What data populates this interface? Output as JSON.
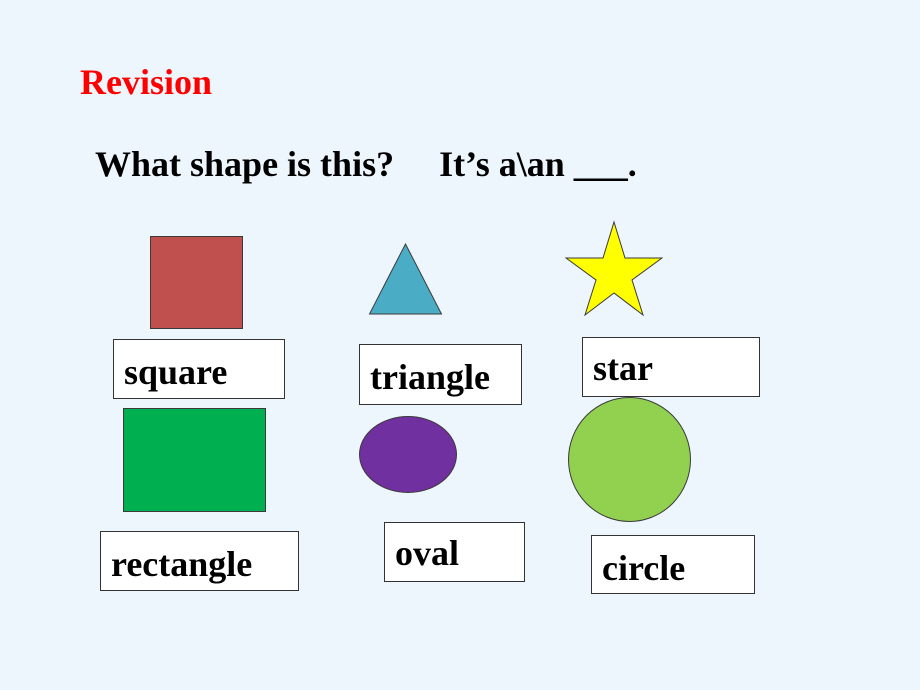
{
  "slide": {
    "title": "Revision",
    "question": "What shape is this?     It’s a\\an ___."
  },
  "shapes": [
    {
      "name": "square",
      "label": "square",
      "color": "#c0504d"
    },
    {
      "name": "triangle",
      "label": "triangle",
      "color": "#4bacc6"
    },
    {
      "name": "star",
      "label": "star",
      "color": "#ffff00"
    },
    {
      "name": "rectangle",
      "label": "rectangle",
      "color": "#00b050"
    },
    {
      "name": "oval",
      "label": "oval",
      "color": "#7030a0"
    },
    {
      "name": "circle",
      "label": "circle",
      "color": "#92d050"
    }
  ]
}
